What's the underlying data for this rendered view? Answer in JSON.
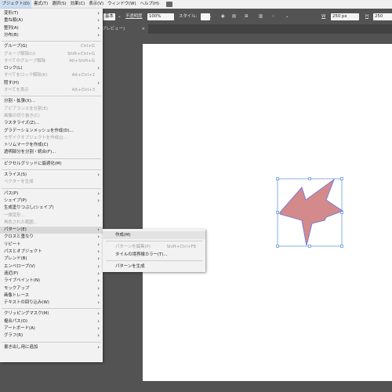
{
  "menubar": {
    "items": [
      "ブジェクト(O)",
      "書式(T)",
      "選択(S)",
      "効果(C)",
      "表示(V)",
      "ウィンドウ(W)",
      "ヘルプ(H)"
    ]
  },
  "controlbar": {
    "style": "基本",
    "opacity_label": "不透明度",
    "opacity": "100%",
    "style_label": "スタイル:",
    "w_label": "W",
    "w_value": "250 px",
    "h_label": "H",
    "h_value": "250"
  },
  "tab": {
    "label": "プレビュー)",
    "close": "×"
  },
  "menu": [
    {
      "label": "変形(T)",
      "arrow": true
    },
    {
      "label": "重ね順(A)",
      "arrow": true
    },
    {
      "label": "整列(A)",
      "arrow": true
    },
    {
      "label": "分布(B)",
      "arrow": true
    },
    {
      "sep": true
    },
    {
      "label": "グループ(G)",
      "shortcut": "Ctrl+G"
    },
    {
      "label": "グループ解除(U)",
      "shortcut": "Shift+Ctrl+G",
      "disabled": true
    },
    {
      "label": "すべてのグループ解除",
      "shortcut": "Alt+Shift+G",
      "disabled": true
    },
    {
      "label": "ロック(L)",
      "arrow": true
    },
    {
      "label": "すべてをロック解除(K)",
      "shortcut": "Alt+Ctrl+2",
      "disabled": true
    },
    {
      "label": "隠す(H)",
      "arrow": true
    },
    {
      "label": "すべてを表示",
      "shortcut": "Alt+Ctrl+3",
      "disabled": true
    },
    {
      "sep": true
    },
    {
      "label": "分割・拡張(X)..."
    },
    {
      "label": "アピアランスを分割(E)",
      "disabled": true
    },
    {
      "label": "画像の切り抜き(C)",
      "disabled": true
    },
    {
      "label": "ラスタライズ(Z)..."
    },
    {
      "label": "グラデーションメッシュを作成(D)..."
    },
    {
      "label": "モザイクオブジェクトを作成(J)...",
      "disabled": true
    },
    {
      "label": "トリムマークを作成(C)"
    },
    {
      "label": "透明部分を分割・統合(F)..."
    },
    {
      "sep": true
    },
    {
      "label": "ピクセルグリッドに最適化(M)"
    },
    {
      "sep": true
    },
    {
      "label": "スライス(S)",
      "arrow": true
    },
    {
      "label": "ベクターを生成",
      "disabled": true
    },
    {
      "sep": true
    },
    {
      "label": "パス(P)",
      "arrow": true
    },
    {
      "label": "シェイプ(P)",
      "arrow": true
    },
    {
      "label": "生成塗りつぶし(シェイプ)"
    },
    {
      "label": "一律変形...",
      "disabled": true,
      "arrow": true
    },
    {
      "label": "再色された範囲...",
      "disabled": true
    },
    {
      "label": "パターン(E)",
      "arrow": true,
      "highlight": true
    },
    {
      "label": "クロスと重なり",
      "arrow": true
    },
    {
      "label": "リピート",
      "arrow": true
    },
    {
      "label": "パスとオブジェクト",
      "arrow": true
    },
    {
      "label": "ブレンド(B)",
      "arrow": true
    },
    {
      "label": "エンベロープ(V)",
      "arrow": true
    },
    {
      "label": "遠近(P)",
      "arrow": true
    },
    {
      "label": "ライブペイント(N)",
      "arrow": true
    },
    {
      "label": "モックアップ",
      "arrow": true
    },
    {
      "label": "画像トレース",
      "arrow": true
    },
    {
      "label": "テキストの回り込み(W)",
      "arrow": true
    },
    {
      "sep": true
    },
    {
      "label": "クリッピングマスク(M)",
      "arrow": true
    },
    {
      "label": "複合パス(O)",
      "arrow": true
    },
    {
      "label": "アートボード(A)",
      "arrow": true
    },
    {
      "label": "グラフ(R)",
      "arrow": true
    },
    {
      "sep": true
    },
    {
      "label": "書き出し用に追加",
      "arrow": true
    }
  ],
  "submenu": [
    {
      "label": "作成(M)",
      "highlight": true
    },
    {
      "sep": true
    },
    {
      "label": "パターンを編集(P)",
      "shortcut": "Shift+Ctrl+F8",
      "disabled": true
    },
    {
      "label": "タイルの境界線カラー(T)..."
    },
    {
      "sep": true
    },
    {
      "label": "パターンを生成"
    }
  ],
  "colors": {
    "shape_fill": "#d48a8a",
    "shape_stroke": "#7a7ad6",
    "selection": "#3b7bd9",
    "pasteboard": "#535353",
    "menu_bg": "#f2f2f2"
  }
}
